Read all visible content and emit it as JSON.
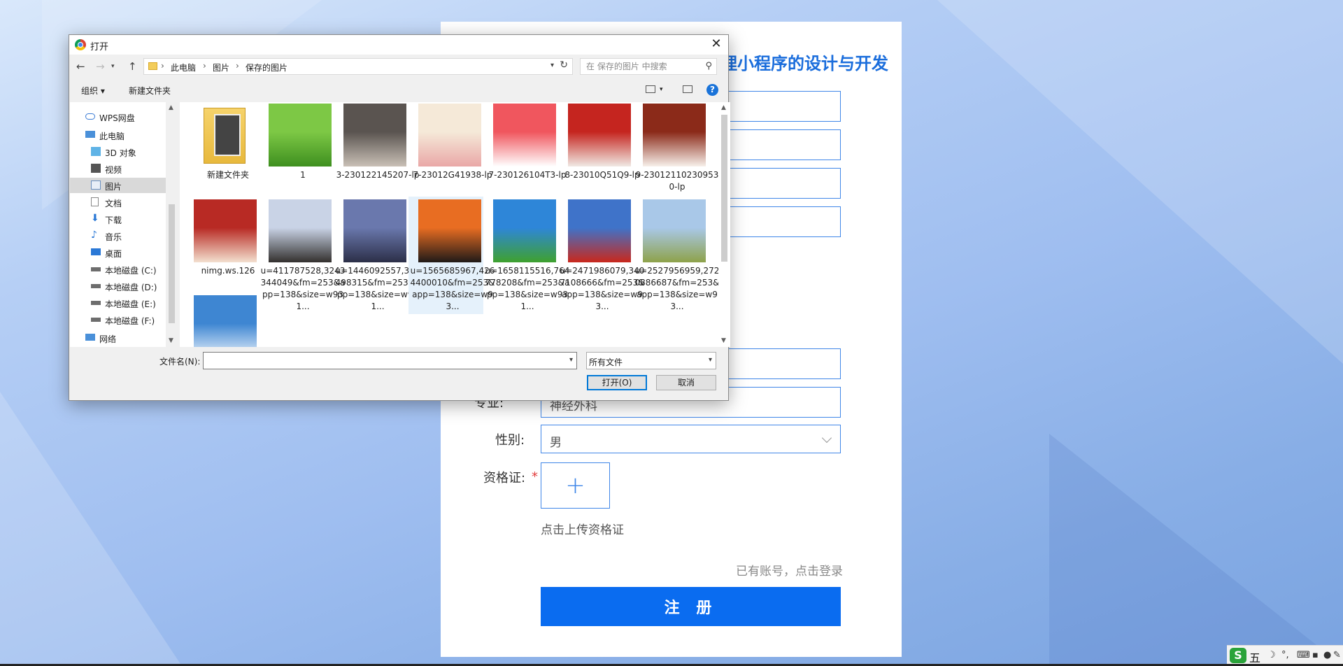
{
  "form": {
    "title": "理小程序的设计与开发",
    "major_label": "专业:",
    "major_value": "神经外科",
    "gender_label": "性别:",
    "gender_value": "男",
    "cert_label": "资格证:",
    "required_mark": "*",
    "upload_hint": "点击上传资格证",
    "login_link": "已有账号，点击登录",
    "register_button": "注 册"
  },
  "dialog": {
    "title": "打开",
    "close_glyph": "✕",
    "breadcrumb": [
      "此电脑",
      "图片",
      "保存的图片"
    ],
    "search_placeholder": "在 保存的图片 中搜索",
    "toolbar": {
      "organize": "组织 ▾",
      "new_folder": "新建文件夹",
      "help": "?"
    },
    "nav": [
      {
        "label": "WPS网盘",
        "icon": "cloud-icon"
      },
      {
        "label": "此电脑",
        "icon": "computer-icon"
      },
      {
        "label": "3D 对象",
        "icon": "3d-objects-icon"
      },
      {
        "label": "视频",
        "icon": "video-icon"
      },
      {
        "label": "图片",
        "icon": "pictures-icon",
        "selected": true
      },
      {
        "label": "文档",
        "icon": "documents-icon"
      },
      {
        "label": "下载",
        "icon": "download-icon"
      },
      {
        "label": "音乐",
        "icon": "music-icon"
      },
      {
        "label": "桌面",
        "icon": "desktop-icon"
      },
      {
        "label": "本地磁盘 (C:)",
        "icon": "drive-icon"
      },
      {
        "label": "本地磁盘 (D:)",
        "icon": "drive-icon"
      },
      {
        "label": "本地磁盘 (E:)",
        "icon": "drive-icon"
      },
      {
        "label": "本地磁盘 (F:)",
        "icon": "drive-icon"
      },
      {
        "label": "网络",
        "icon": "network-icon"
      }
    ],
    "files": [
      {
        "name": "新建文件夹",
        "kind": "folder"
      },
      {
        "name": "1",
        "kind": "image",
        "colors": [
          "#7dc845",
          "#3e8f1f"
        ]
      },
      {
        "name": "3-230122145207-lp",
        "kind": "image",
        "colors": [
          "#5a5450",
          "#c9c0b6"
        ]
      },
      {
        "name": "7-23012G41938-lp",
        "kind": "image",
        "colors": [
          "#f5e9d8",
          "#e9a7a7"
        ]
      },
      {
        "name": "7-230126104T3-lp",
        "kind": "image",
        "colors": [
          "#f0565e",
          "#ffffff"
        ]
      },
      {
        "name": "8-23010Q51Q9-lp",
        "kind": "image",
        "colors": [
          "#c5251f",
          "#f0e9e4"
        ]
      },
      {
        "name": "9-230121102309530-lp",
        "kind": "image",
        "colors": [
          "#8b2a19",
          "#f7f0ea"
        ]
      },
      {
        "name": "nimg.ws.126",
        "kind": "image",
        "colors": [
          "#b82a24",
          "#f3e0cf"
        ]
      },
      {
        "name": "u=411787528,3243344049&fm=253&app=138&size=w931...",
        "kind": "image",
        "colors": [
          "#c9d3e6",
          "#33302e"
        ]
      },
      {
        "name": "u=1446092557,371498315&fm=253&app=138&size=w931...",
        "kind": "image",
        "colors": [
          "#6a78ad",
          "#2c2f48"
        ]
      },
      {
        "name": "u=1565685967,4264400010&fm=253&app=138&size=w93...",
        "kind": "image",
        "colors": [
          "#e86d22",
          "#201a18"
        ],
        "selected": true
      },
      {
        "name": "u=1658115516,764778208&fm=253&app=138&size=w931...",
        "kind": "image",
        "colors": [
          "#2e86d8",
          "#3fa12e"
        ]
      },
      {
        "name": "u=2471986079,3407108666&fm=253&app=138&size=w93...",
        "kind": "image",
        "colors": [
          "#3f73c9",
          "#c9281c"
        ]
      },
      {
        "name": "u=2527956959,2720886687&fm=253&app=138&size=w93...",
        "kind": "image",
        "colors": [
          "#a9c8e8",
          "#8ea24a"
        ]
      },
      {
        "name": "",
        "kind": "image",
        "colors": [
          "#3e86d2",
          "#eaf2fb"
        ]
      }
    ],
    "filename_label": "文件名(N):",
    "filename_value": "",
    "filetype": "所有文件",
    "open_button": "打开(O)",
    "cancel_button": "取消"
  },
  "ime": {
    "logo": "S",
    "mode": "五"
  }
}
